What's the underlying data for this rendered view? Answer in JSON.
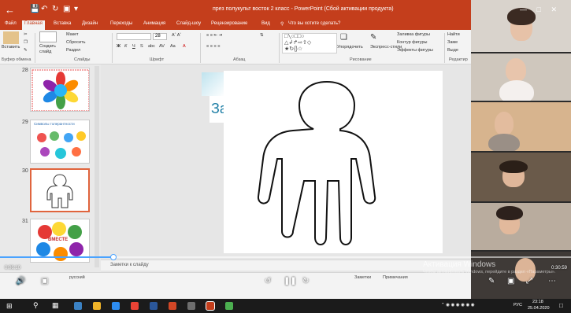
{
  "titlebar": {
    "back_icon": "arrow-left-icon",
    "doc_title": "през полукульт восток 2 класс - PowerPoint (Сбой активации продукта)",
    "accent": "#c43e1c"
  },
  "ribbon_tabs": [
    "Файл",
    "Главная",
    "Вставка",
    "Дизайн",
    "Переходы",
    "Анимация",
    "Слайд-шоу",
    "Рецензирование",
    "Вид",
    "Что вы хотите сделать?"
  ],
  "ribbon": {
    "paste": "Вставить",
    "clipboard_group": "Буфер обмена",
    "create_slide": "Создать",
    "create_slide2": "слайд",
    "layout": "Макет",
    "reset": "Сбросить",
    "section": "Раздел",
    "slides_group": "Слайды",
    "font_group": "Шрифт",
    "font_size": "28",
    "paragraph_group": "Абзац",
    "arrange": "Упорядочить",
    "quick_styles": "Экспресс-стили",
    "drawing_group": "Рисование",
    "shape_fill": "Заливка фигуры",
    "shape_outline": "Контур фигуры",
    "shape_effects": "Эффекты фигуры",
    "find": "Найти",
    "replace": "Заме",
    "select": "Выде",
    "editing_group": "Редактир"
  },
  "thumbnails": [
    {
      "num": "28"
    },
    {
      "num": "29",
      "caption": "Символы толерантности"
    },
    {
      "num": "30",
      "selected": true
    },
    {
      "num": "31",
      "caption": "ВМЕСТЕ"
    }
  ],
  "slide": {
    "title_fragment": "За"
  },
  "notes": {
    "label": "Заметки к слайду"
  },
  "statusbar": {
    "language": "русский",
    "notes_btn": "Заметки",
    "comments_btn": "Примечания"
  },
  "player": {
    "time_current": "0:06:10",
    "time_total": "0:30:59",
    "progress": 0.199
  },
  "activation": {
    "title": "Активация Windows",
    "subtitle": "Чтобы активировать Windows, перейдите в раздел «Параметры»."
  },
  "taskbar": {
    "lang": "РУС",
    "time": "23:18",
    "date": "25.04.2020"
  }
}
